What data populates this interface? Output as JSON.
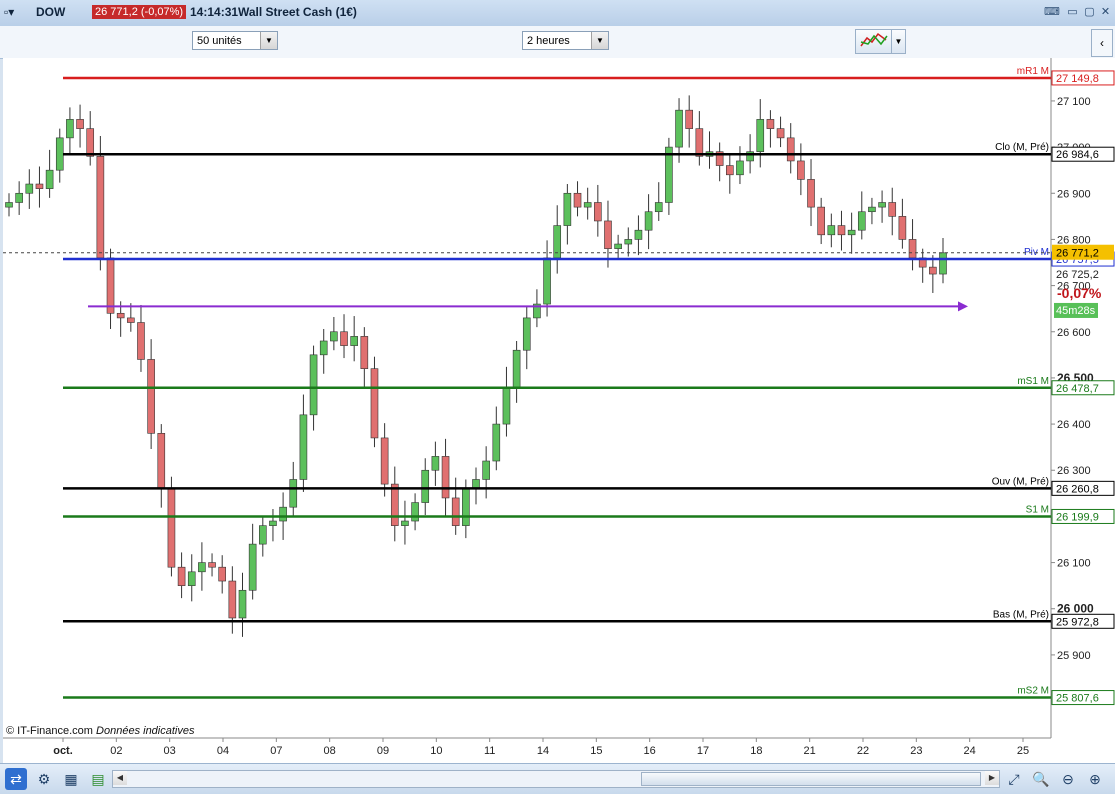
{
  "titlebar": {
    "symbol": "DOW",
    "price_badge": "26 771,2 (-0,07%)",
    "time": "14:14:31",
    "instrument": "Wall Street Cash (1€)"
  },
  "toolbar": {
    "units_select": "50 unités",
    "period_select": "2 heures"
  },
  "chart_data": {
    "type": "candlestick",
    "title": "",
    "ylim": [
      25720,
      27180
    ],
    "y_ticks": [
      "27 100",
      "27 000",
      "26 900",
      "26 800",
      "26 700",
      "26 600",
      "26 500",
      "26 400",
      "26 300",
      "26 200",
      "26 100",
      "26 000",
      "25 900"
    ],
    "bold_y_ticks": [
      "26 500",
      "26 000"
    ],
    "x_labels": [
      "oct.",
      "02",
      "03",
      "04",
      "07",
      "08",
      "09",
      "10",
      "11",
      "14",
      "15",
      "16",
      "17",
      "18",
      "21",
      "22",
      "23",
      "24",
      "25"
    ],
    "levels": [
      {
        "name": "mR1 M",
        "value": 27149.8,
        "label": "27 149,8",
        "color": "#d81e1e"
      },
      {
        "name": "Clo (M, Pré)",
        "value": 26984.6,
        "label": "26 984,6",
        "color": "#000000"
      },
      {
        "name": "Piv M",
        "value": 26757.5,
        "label": "26 757,5",
        "color": "#1f2fd0"
      },
      {
        "name": "mS1 M",
        "value": 26478.7,
        "label": "26 478,7",
        "color": "#1a7a1a"
      },
      {
        "name": "Ouv (M, Pré)",
        "value": 26260.8,
        "label": "26 260,8",
        "color": "#000000"
      },
      {
        "name": "S1 M",
        "value": 26199.9,
        "label": "26 199,9",
        "color": "#1a7a1a"
      },
      {
        "name": "Bas (M, Pré)",
        "value": 25972.8,
        "label": "25 972,8",
        "color": "#000000"
      },
      {
        "name": "mS2 M",
        "value": 25807.6,
        "label": "25 807,6",
        "color": "#1a7a1a"
      }
    ],
    "current_price": {
      "value": 26771.2,
      "label": "26 771,2"
    },
    "extra_price": {
      "value": 26725.2,
      "label": "26 725,2"
    },
    "change": "-0,07%",
    "countdown": "45m28s",
    "trend_line_value": 26655,
    "closes": [
      26880,
      26900,
      26920,
      26910,
      26950,
      27020,
      27060,
      27040,
      26980,
      26760,
      26640,
      26630,
      26620,
      26540,
      26380,
      26260,
      26090,
      26050,
      26080,
      26100,
      26090,
      26060,
      25980,
      26040,
      26140,
      26180,
      26190,
      26220,
      26280,
      26420,
      26550,
      26580,
      26600,
      26570,
      26590,
      26520,
      26370,
      26270,
      26180,
      26190,
      26230,
      26300,
      26330,
      26240,
      26180,
      26260,
      26280,
      26320,
      26400,
      26480,
      26560,
      26630,
      26660,
      26760,
      26830,
      26900,
      26870,
      26880,
      26840,
      26780,
      26790,
      26800,
      26820,
      26860,
      26880,
      27000,
      27080,
      27040,
      26980,
      26990,
      26960,
      26940,
      26970,
      26990,
      27060,
      27040,
      27020,
      26970,
      26930,
      26870,
      26810,
      26830,
      26810,
      26820,
      26860,
      26870,
      26880,
      26850,
      26800,
      26760,
      26740,
      26725,
      26771
    ]
  },
  "footer": {
    "copyright": "© IT-Finance.com",
    "note": "Données indicatives"
  }
}
